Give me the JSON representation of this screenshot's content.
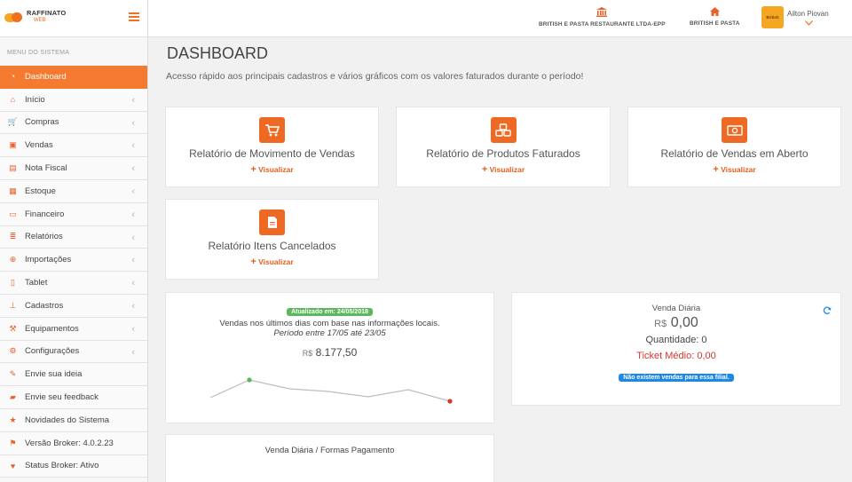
{
  "brand": {
    "name": "RAFFINATO",
    "sub": "WEB"
  },
  "colors": {
    "accent": "#f47a30",
    "icon": "#e8622b",
    "success": "#5cb85c",
    "info": "#1e88e5",
    "danger": "#d9342b"
  },
  "sidebar": {
    "title": "MENU DO SISTEMA",
    "items": [
      {
        "label": "Dashboard",
        "icon": "dashboard-icon",
        "active": true,
        "chevron": false
      },
      {
        "label": "Início",
        "icon": "home-icon",
        "chevron": true
      },
      {
        "label": "Compras",
        "icon": "cart-icon",
        "chevron": true
      },
      {
        "label": "Vendas",
        "icon": "briefcase-icon",
        "chevron": true
      },
      {
        "label": "Nota Fiscal",
        "icon": "file-icon",
        "chevron": true
      },
      {
        "label": "Estoque",
        "icon": "grid-icon",
        "chevron": true
      },
      {
        "label": "Financeiro",
        "icon": "money-icon",
        "chevron": true
      },
      {
        "label": "Relatórios",
        "icon": "list-icon",
        "chevron": true
      },
      {
        "label": "Importações",
        "icon": "import-icon",
        "chevron": true
      },
      {
        "label": "Tablet",
        "icon": "tablet-icon",
        "chevron": true
      },
      {
        "label": "Cadastros",
        "icon": "sitemap-icon",
        "chevron": true
      },
      {
        "label": "Equipamentos",
        "icon": "wrench-icon",
        "chevron": true
      },
      {
        "label": "Configurações",
        "icon": "gears-icon",
        "chevron": true
      },
      {
        "label": "Envie sua ideia",
        "icon": "edit-icon",
        "chevron": false
      },
      {
        "label": "Envie seu feedback",
        "icon": "comment-icon",
        "chevron": false
      },
      {
        "label": "Novidades do Sistema",
        "icon": "star-icon",
        "chevron": false
      },
      {
        "label": "Versão Broker: 4.0.2.23",
        "icon": "flag-icon",
        "chevron": false
      },
      {
        "label": "Status Broker: Ativo",
        "icon": "heart-icon",
        "chevron": false
      }
    ]
  },
  "topbar": {
    "company": "BRITISH E PASTA RESTAURANTE LTDA-EPP",
    "branch": "BRITISH E PASTA",
    "user": "Ailton Piovan",
    "avatar_text": "British"
  },
  "main": {
    "title": "DASHBOARD",
    "subtitle": "Acesso rápido aos principais cadastros e vários gráficos com os valores faturados durante o período!",
    "reports": [
      {
        "title": "Relatório de Movimento de Vendas",
        "link": "Visualizar",
        "icon": "cart-icon"
      },
      {
        "title": "Relatório de Produtos Faturados",
        "link": "Visualizar",
        "icon": "cubes-icon"
      },
      {
        "title": "Relatório de Vendas em Aberto",
        "link": "Visualizar",
        "icon": "money-icon"
      },
      {
        "title": "Relatório Itens Cancelados",
        "link": "Visualizar",
        "icon": "document-icon"
      }
    ],
    "sales_chart": {
      "badge": "Atualizado em: 24/05/2018",
      "line1": "Vendas nos últimos dias com base nas informações locais.",
      "line2": "Período entre 17/05 até 23/05",
      "currency": "R$",
      "total": "8.177,50"
    },
    "daily": {
      "title": "Venda Diária",
      "currency": "R$",
      "value": "0,00",
      "quantity": "Quantidade: 0",
      "ticket": "Ticket Médio: 0,00",
      "notice": "Não existem vendas para essa filial."
    },
    "payments": {
      "title": "Venda Diária / Formas Pagamento"
    }
  }
}
